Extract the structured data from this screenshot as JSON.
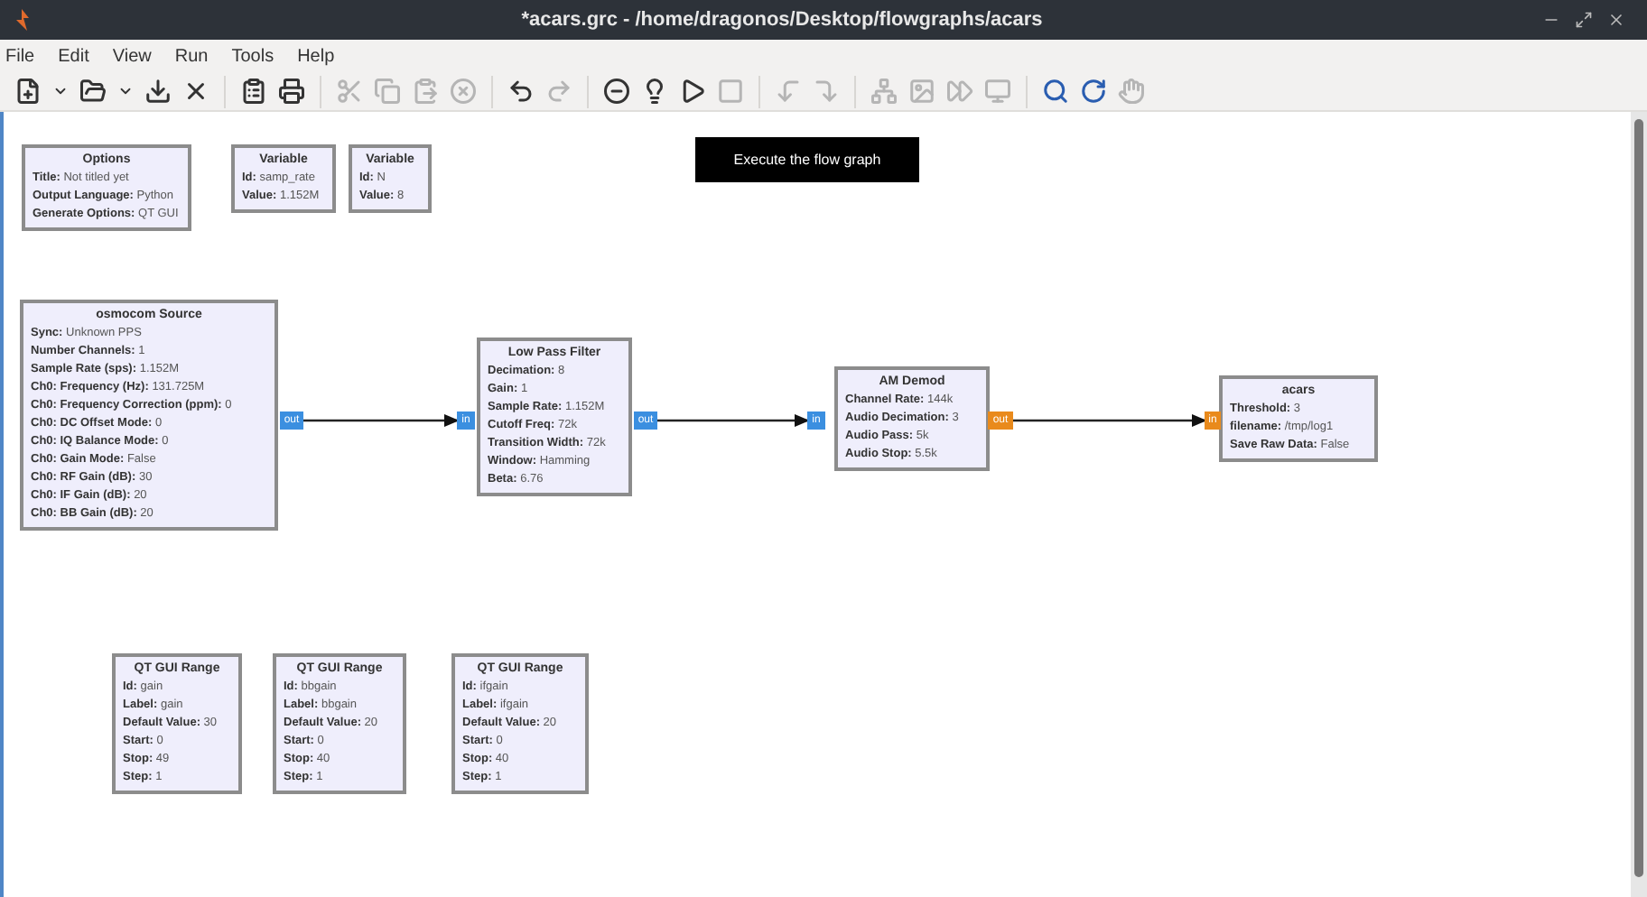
{
  "window": {
    "title": "*acars.grc - /home/dragonos/Desktop/flowgraphs/acars"
  },
  "menu": [
    "File",
    "Edit",
    "View",
    "Run",
    "Tools",
    "Help"
  ],
  "toolbar": [
    {
      "kind": "new",
      "disabled": false
    },
    {
      "kind": "caret",
      "disabled": false
    },
    {
      "kind": "open",
      "disabled": false
    },
    {
      "kind": "caret",
      "disabled": false
    },
    {
      "kind": "save",
      "disabled": false
    },
    {
      "kind": "close",
      "disabled": false
    },
    {
      "kind": "sep"
    },
    {
      "kind": "report",
      "disabled": false
    },
    {
      "kind": "print",
      "disabled": false
    },
    {
      "kind": "sep"
    },
    {
      "kind": "cut",
      "disabled": true
    },
    {
      "kind": "copy",
      "disabled": true
    },
    {
      "kind": "paste",
      "disabled": true
    },
    {
      "kind": "delete",
      "disabled": true
    },
    {
      "kind": "sep"
    },
    {
      "kind": "undo",
      "disabled": false
    },
    {
      "kind": "redo",
      "disabled": true
    },
    {
      "kind": "sep"
    },
    {
      "kind": "disable",
      "disabled": false
    },
    {
      "kind": "bypass",
      "disabled": false
    },
    {
      "kind": "execute",
      "disabled": false
    },
    {
      "kind": "stop",
      "disabled": true
    },
    {
      "kind": "sep"
    },
    {
      "kind": "rotate-left",
      "disabled": true
    },
    {
      "kind": "rotate-right",
      "disabled": true
    },
    {
      "kind": "sep"
    },
    {
      "kind": "hier",
      "disabled": true
    },
    {
      "kind": "screenshot",
      "disabled": true
    },
    {
      "kind": "forward",
      "disabled": true
    },
    {
      "kind": "terminal",
      "disabled": true
    },
    {
      "kind": "sep"
    },
    {
      "kind": "find",
      "disabled": false
    },
    {
      "kind": "reload",
      "disabled": false
    },
    {
      "kind": "hand",
      "disabled": true
    }
  ],
  "tooltip": "Execute the flow graph",
  "blocks": [
    {
      "title": "Options",
      "params": [
        {
          "name": "Title:",
          "value": "Not titled yet"
        },
        {
          "name": "Output Language:",
          "value": "Python"
        },
        {
          "name": "Generate Options:",
          "value": "QT GUI"
        }
      ]
    },
    {
      "title": "Variable",
      "params": [
        {
          "name": "Id:",
          "value": "samp_rate"
        },
        {
          "name": "Value:",
          "value": "1.152M"
        }
      ]
    },
    {
      "title": "Variable",
      "params": [
        {
          "name": "Id:",
          "value": "N"
        },
        {
          "name": "Value:",
          "value": "8"
        }
      ]
    },
    {
      "title": "osmocom Source",
      "params": [
        {
          "name": "Sync:",
          "value": "Unknown PPS"
        },
        {
          "name": "Number Channels:",
          "value": "1"
        },
        {
          "name": "Sample Rate (sps):",
          "value": "1.152M"
        },
        {
          "name": "Ch0: Frequency (Hz):",
          "value": "131.725M"
        },
        {
          "name": "Ch0: Frequency Correction (ppm):",
          "value": "0"
        },
        {
          "name": "Ch0: DC Offset Mode:",
          "value": "0"
        },
        {
          "name": "Ch0: IQ Balance Mode:",
          "value": "0"
        },
        {
          "name": "Ch0: Gain Mode:",
          "value": "False"
        },
        {
          "name": "Ch0: RF Gain (dB):",
          "value": "30"
        },
        {
          "name": "Ch0: IF Gain (dB):",
          "value": "20"
        },
        {
          "name": "Ch0: BB Gain (dB):",
          "value": "20"
        }
      ]
    },
    {
      "title": "Low Pass Filter",
      "params": [
        {
          "name": "Decimation:",
          "value": "8"
        },
        {
          "name": "Gain:",
          "value": "1"
        },
        {
          "name": "Sample Rate:",
          "value": "1.152M"
        },
        {
          "name": "Cutoff Freq:",
          "value": "72k"
        },
        {
          "name": "Transition Width:",
          "value": "72k"
        },
        {
          "name": "Window:",
          "value": "Hamming"
        },
        {
          "name": "Beta:",
          "value": "6.76"
        }
      ]
    },
    {
      "title": "AM Demod",
      "params": [
        {
          "name": "Channel Rate:",
          "value": "144k"
        },
        {
          "name": "Audio Decimation:",
          "value": "3"
        },
        {
          "name": "Audio Pass:",
          "value": "5k"
        },
        {
          "name": "Audio Stop:",
          "value": "5.5k"
        }
      ]
    },
    {
      "title": "acars",
      "params": [
        {
          "name": "Threshold:",
          "value": "3"
        },
        {
          "name": "filename:",
          "value": "/tmp/log1"
        },
        {
          "name": "Save Raw Data:",
          "value": "False"
        }
      ]
    },
    {
      "title": "QT GUI Range",
      "params": [
        {
          "name": "Id:",
          "value": "gain"
        },
        {
          "name": "Label:",
          "value": "gain"
        },
        {
          "name": "Default Value:",
          "value": "30"
        },
        {
          "name": "Start:",
          "value": "0"
        },
        {
          "name": "Stop:",
          "value": "49"
        },
        {
          "name": "Step:",
          "value": "1"
        }
      ]
    },
    {
      "title": "QT GUI Range",
      "params": [
        {
          "name": "Id:",
          "value": "bbgain"
        },
        {
          "name": "Label:",
          "value": "bbgain"
        },
        {
          "name": "Default Value:",
          "value": "20"
        },
        {
          "name": "Start:",
          "value": "0"
        },
        {
          "name": "Stop:",
          "value": "40"
        },
        {
          "name": "Step:",
          "value": "1"
        }
      ]
    },
    {
      "title": "QT GUI Range",
      "params": [
        {
          "name": "Id:",
          "value": "ifgain"
        },
        {
          "name": "Label:",
          "value": "ifgain"
        },
        {
          "name": "Default Value:",
          "value": "20"
        },
        {
          "name": "Start:",
          "value": "0"
        },
        {
          "name": "Stop:",
          "value": "40"
        },
        {
          "name": "Step:",
          "value": "1"
        }
      ]
    }
  ],
  "ports": [
    {
      "label": "out",
      "color": "#3b8fe0"
    },
    {
      "label": "in",
      "color": "#3b8fe0"
    },
    {
      "label": "out",
      "color": "#3b8fe0"
    },
    {
      "label": "in",
      "color": "#3b8fe0"
    },
    {
      "label": "out",
      "color": "#e98a1c"
    },
    {
      "label": "in",
      "color": "#e98a1c"
    }
  ]
}
